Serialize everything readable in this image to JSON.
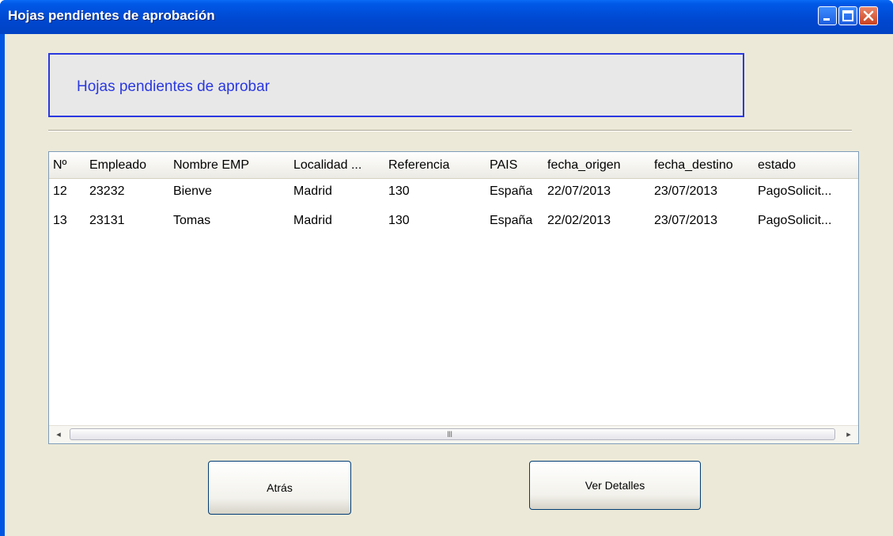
{
  "window": {
    "title": "Hojas pendientes de aprobación"
  },
  "header": {
    "text": "Hojas pendientes de aprobar"
  },
  "table": {
    "columns": [
      "Nº",
      "Empleado",
      "Nombre EMP",
      "Localidad ...",
      "Referencia",
      "PAIS",
      "fecha_origen",
      "fecha_destino",
      "estado"
    ],
    "rows": [
      [
        "12",
        "23232",
        "Bienve",
        "Madrid",
        "130",
        "España",
        "22/07/2013",
        "23/07/2013",
        "PagoSolicit..."
      ],
      [
        "13",
        "23131",
        "Tomas",
        "Madrid",
        "130",
        "España",
        "22/02/2013",
        "23/07/2013",
        "PagoSolicit..."
      ]
    ]
  },
  "scrollbar": {
    "grip": "III",
    "left_arrow": "◂",
    "right_arrow": "▸"
  },
  "buttons": {
    "back": "Atrás",
    "details": "Ver Detalles"
  },
  "colors": {
    "titlebar": "#0047cf",
    "header_text": "#2a38e0",
    "client_bg": "#ece9d8",
    "close_button": "#c9411f"
  }
}
